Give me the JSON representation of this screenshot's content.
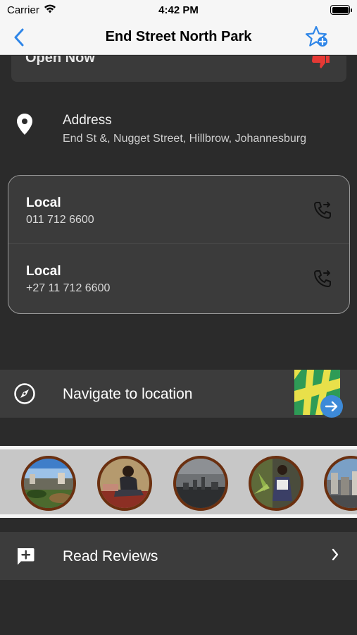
{
  "status_bar": {
    "carrier": "Carrier",
    "time": "4:42 PM"
  },
  "nav": {
    "title": "End Street North Park",
    "back_icon": "chevron-left-icon",
    "favorite_icon": "star-add-icon"
  },
  "open_status": {
    "text": "Open Now",
    "icon": "thumbs-down-icon"
  },
  "address": {
    "label": "Address",
    "value": "End St &, Nugget Street, Hillbrow, Johannesburg"
  },
  "phones": [
    {
      "label": "Local",
      "number": "011 712 6600"
    },
    {
      "label": "Local",
      "number": "+27 11 712 6600"
    }
  ],
  "navigate": {
    "label": "Navigate to location"
  },
  "photos": [
    {
      "name": "park-landscape"
    },
    {
      "name": "person-sitting"
    },
    {
      "name": "city-skyline-grey"
    },
    {
      "name": "person-with-plants"
    },
    {
      "name": "city-buildings"
    }
  ],
  "reviews": {
    "label": "Read Reviews"
  },
  "colors": {
    "accent": "#2f86e8",
    "background": "#2b2b2b",
    "row": "#3c3c3c"
  }
}
